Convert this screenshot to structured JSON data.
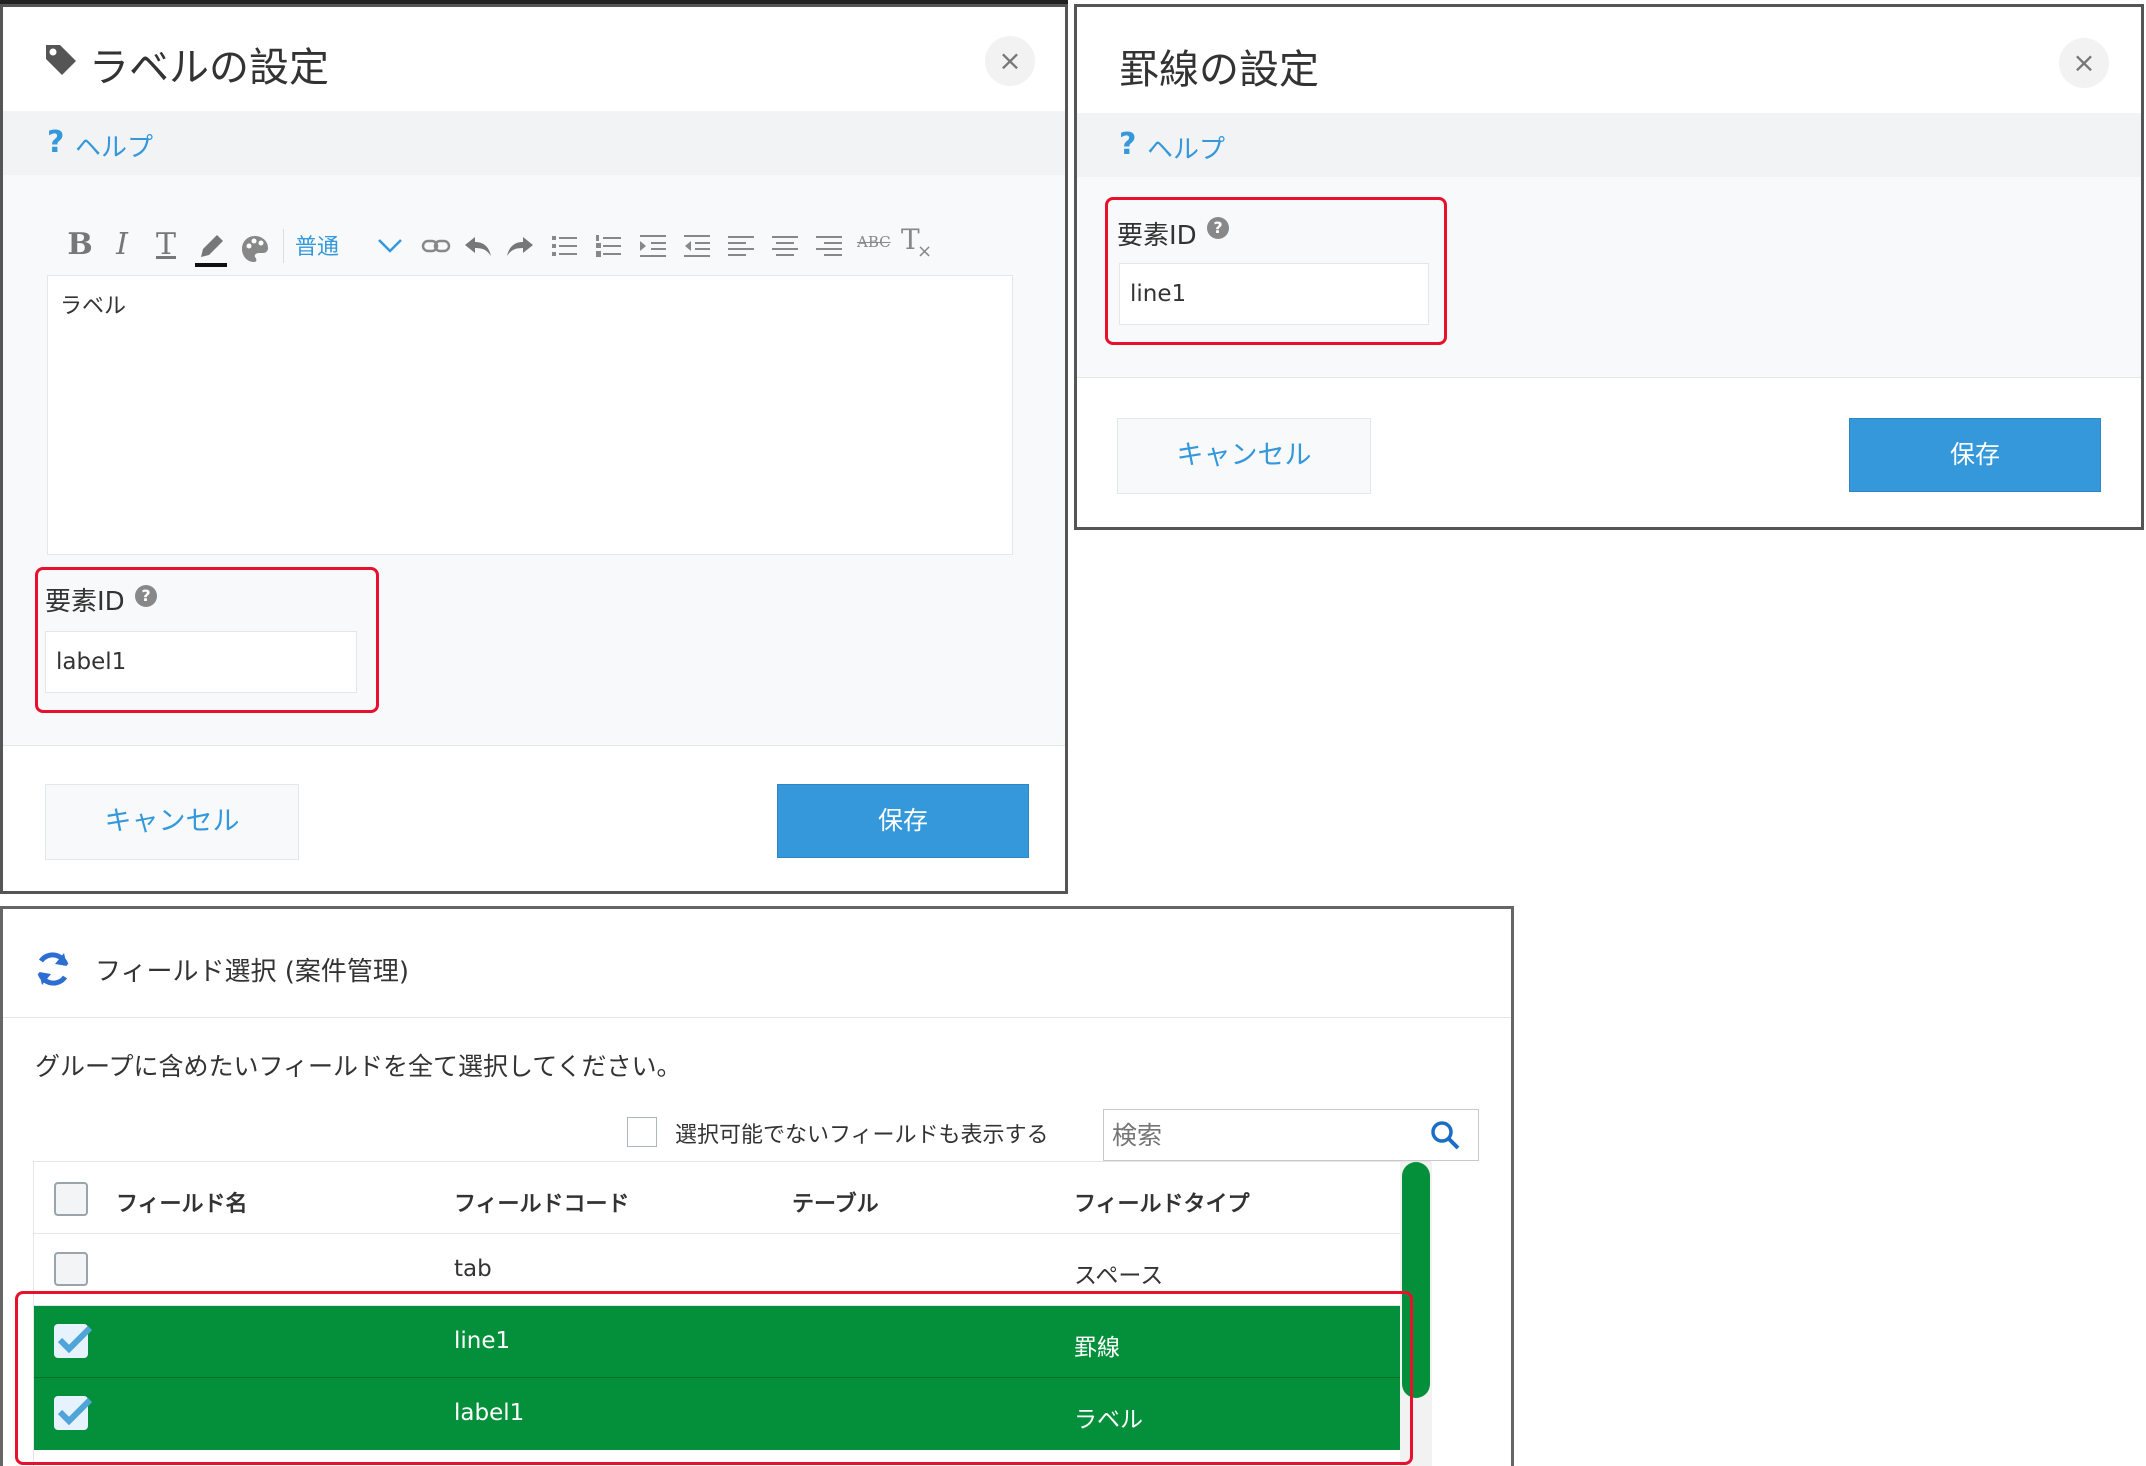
{
  "label_dialog": {
    "title": "ラベルの設定",
    "close": "×",
    "help_q": "?",
    "help": "ヘルプ",
    "toolbar": {
      "bold": "B",
      "italic": "I",
      "underline": "T",
      "format": "普通",
      "strike": "ABC",
      "clear": "T"
    },
    "editor_text": "ラベル",
    "element_id_label": "要素ID",
    "element_id_value": "label1",
    "cancel": "キャンセル",
    "save": "保存",
    "colors": {
      "accent": "#3498db",
      "highlight": "#e8112d"
    }
  },
  "line_dialog": {
    "title": "罫線の設定",
    "close": "×",
    "help_q": "?",
    "help": "ヘルプ",
    "element_id_label": "要素ID",
    "element_id_value": "line1",
    "cancel": "キャンセル",
    "save": "保存"
  },
  "field_dialog": {
    "title": "フィールド選択 (案件管理)",
    "instruction": "グループに含めたいフィールドを全て選択してください。",
    "show_unselectable_label": "選択可能でないフィールドも表示する",
    "search_placeholder": "検索",
    "columns": [
      "フィールド名",
      "フィールドコード",
      "テーブル",
      "フィールドタイプ"
    ],
    "rows": [
      {
        "name": "",
        "code": "tab",
        "table": "",
        "type": "スペース",
        "checked": false
      },
      {
        "name": "",
        "code": "line1",
        "table": "",
        "type": "罫線",
        "checked": true
      },
      {
        "name": "",
        "code": "label1",
        "table": "",
        "type": "ラベル",
        "checked": true
      }
    ],
    "colors": {
      "selected_row": "#04903a",
      "scrollbar": "#04903a",
      "refresh_icon": "#2c6fd1"
    }
  }
}
